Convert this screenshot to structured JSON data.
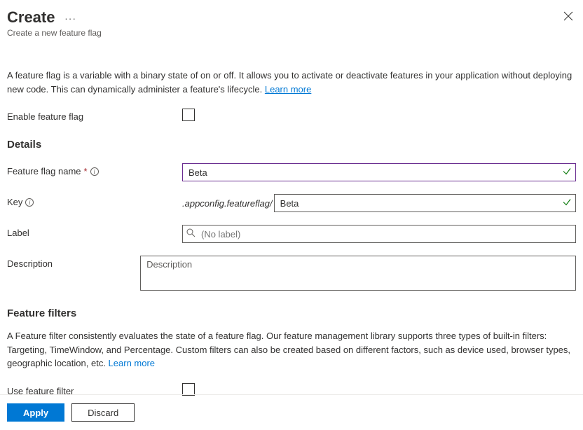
{
  "header": {
    "title": "Create",
    "subtitle": "Create a new feature flag"
  },
  "intro": {
    "text": "A feature flag is a variable with a binary state of on or off. It allows you to activate or deactivate features in your application without deploying new code. This can dynamically administer a feature's lifecycle. ",
    "learnMore": "Learn more"
  },
  "enable": {
    "label": "Enable feature flag"
  },
  "details": {
    "heading": "Details",
    "nameLabel": "Feature flag name",
    "nameValue": "Beta",
    "keyLabel": "Key",
    "keyPrefix": ".appconfig.featureflag/",
    "keyValue": "Beta",
    "labelLabel": "Label",
    "labelPlaceholder": "(No label)",
    "descLabel": "Description",
    "descPlaceholder": "Description"
  },
  "filters": {
    "heading": "Feature filters",
    "text": "A Feature filter consistently evaluates the state of a feature flag. Our feature management library supports three types of built-in filters: Targeting, TimeWindow, and Percentage. Custom filters can also be created based on different factors, such as device used, browser types, geographic location, etc. ",
    "learnMore": "Learn more",
    "useLabel": "Use feature filter"
  },
  "footer": {
    "apply": "Apply",
    "discard": "Discard"
  }
}
